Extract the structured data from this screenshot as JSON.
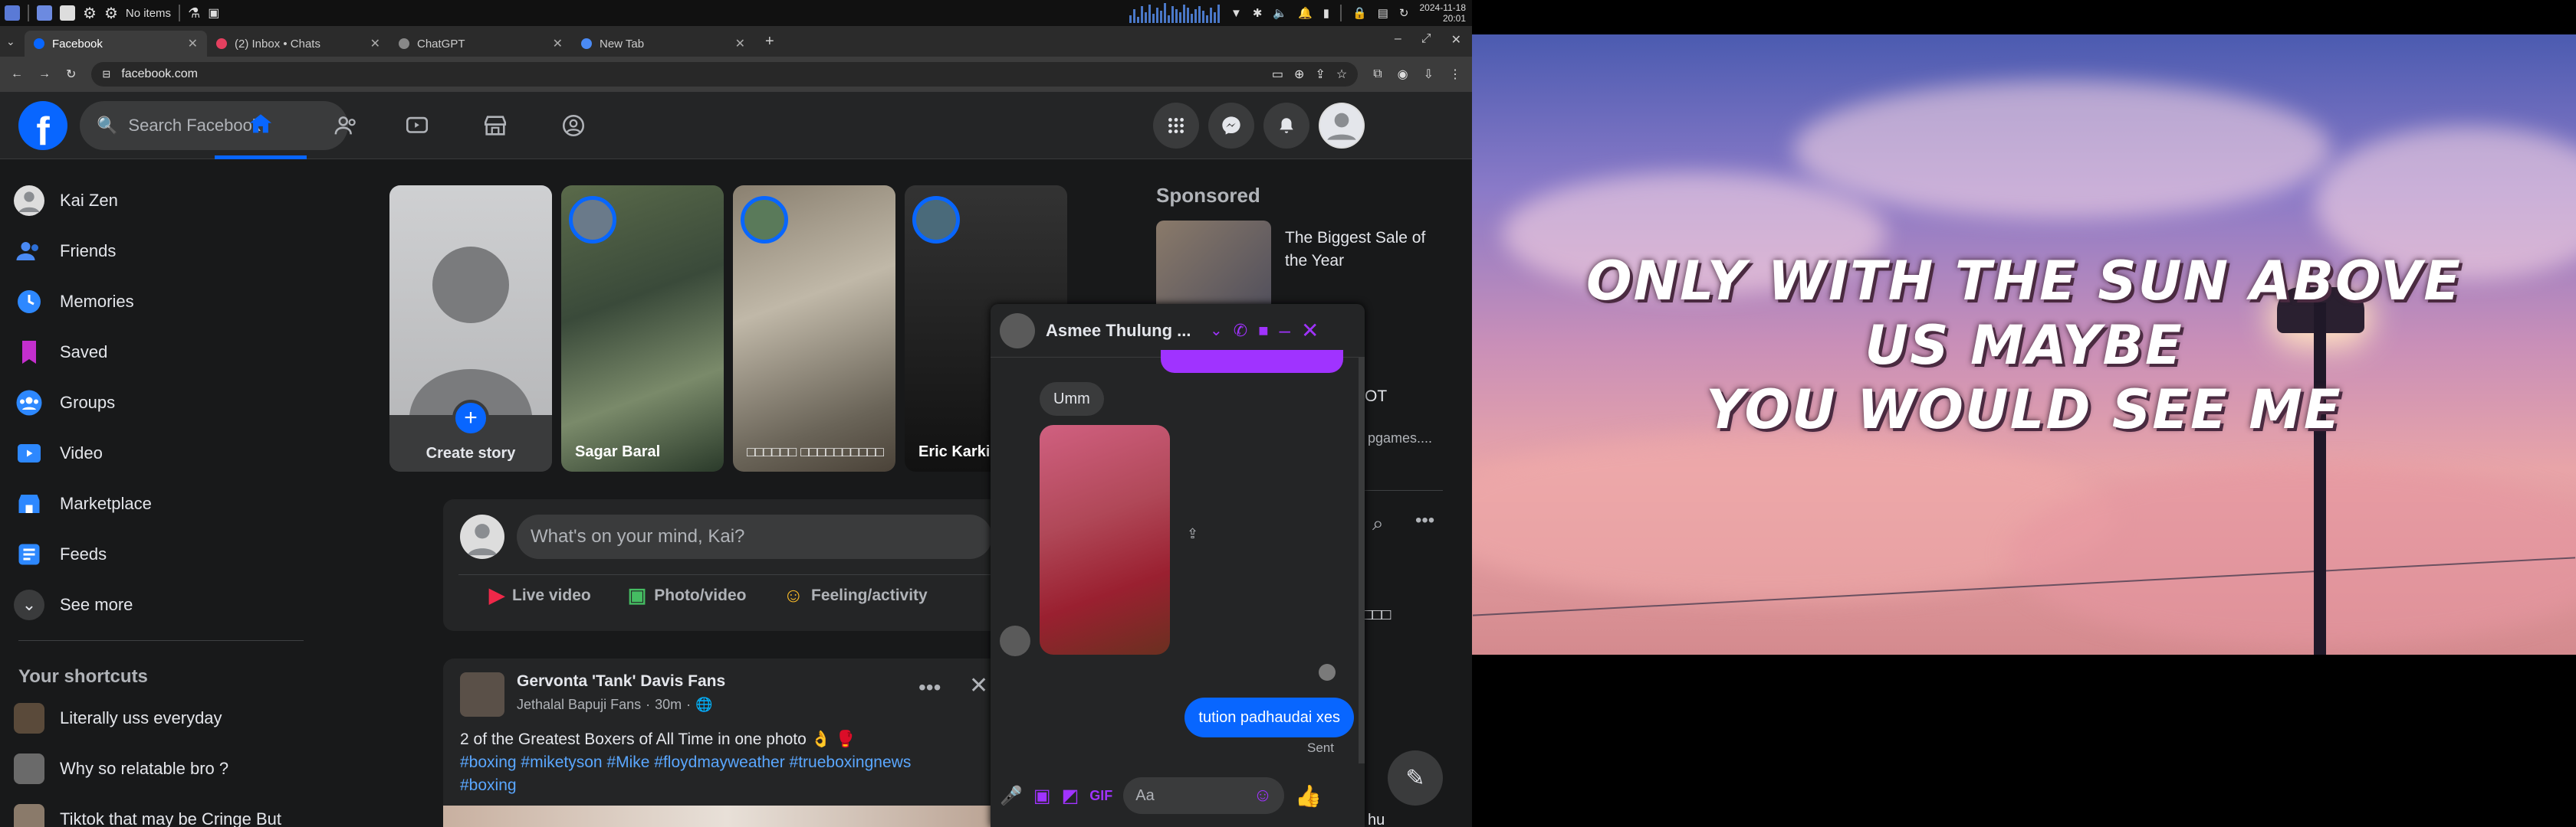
{
  "taskbar": {
    "no_items": "No items",
    "clock_date": "2024-11-18",
    "clock_time": "20:01"
  },
  "browser": {
    "tabs": [
      {
        "label": "Facebook",
        "color": "#0866ff"
      },
      {
        "label": "(2) Inbox • Chats",
        "color": "#e4405f"
      },
      {
        "label": "ChatGPT",
        "color": "#888888"
      },
      {
        "label": "New Tab",
        "color": "#4a8af4"
      }
    ],
    "url": "facebook.com"
  },
  "fb": {
    "search_placeholder": "Search Facebook",
    "left_menu": [
      {
        "label": "Kai Zen",
        "icon": "avatar"
      },
      {
        "label": "Friends",
        "icon": "friends-icon"
      },
      {
        "label": "Memories",
        "icon": "memories-icon"
      },
      {
        "label": "Saved",
        "icon": "saved-icon"
      },
      {
        "label": "Groups",
        "icon": "groups-icon"
      },
      {
        "label": "Video",
        "icon": "video-icon"
      },
      {
        "label": "Marketplace",
        "icon": "marketplace-icon"
      },
      {
        "label": "Feeds",
        "icon": "feeds-icon"
      },
      {
        "label": "See more",
        "icon": "chevron-down-icon"
      }
    ],
    "shortcuts_title": "Your shortcuts",
    "shortcuts": [
      "Literally uss everyday",
      "Why so relatable bro ?",
      "Tiktok that may be Cringe But"
    ],
    "stories": [
      {
        "label": "Create story"
      },
      {
        "label": "Sagar Baral"
      },
      {
        "label": "□□□□□□ □□□□□□□□□□"
      },
      {
        "label": "Eric Karki"
      }
    ],
    "composer_placeholder": "What's on your mind, Kai?",
    "composer_actions": [
      "Live video",
      "Photo/video",
      "Feeling/activity"
    ],
    "post": {
      "page": "Gervonta 'Tank' Davis Fans",
      "author": "Jethalal Bapuji Fans",
      "time": "30m",
      "text": "2 of the Greatest Boxers of All Time in one photo 👌 🥊",
      "tags": "#boxing #miketyson #Mike #floydmayweather #trueboxingnews",
      "tags2": "#boxing"
    },
    "sponsored_title": "Sponsored",
    "ad": {
      "title": "The Biggest Sale of the Year",
      "sub": "...p",
      "extra": "OT",
      "domain": "pgames...."
    },
    "contact_partial": "□□□□",
    "bottom_partial": "hu"
  },
  "chat": {
    "name": "Asmee Thulung ...",
    "msg_in": "Umm",
    "msg_out": "tution padhaudai xes",
    "status": "Sent",
    "input_placeholder": "Aa"
  },
  "wallpaper": {
    "line1": "ONLY WITH THE SUN ABOVE",
    "line2": "US MAYBE",
    "line3": "YOU WOULD SEE ME"
  }
}
